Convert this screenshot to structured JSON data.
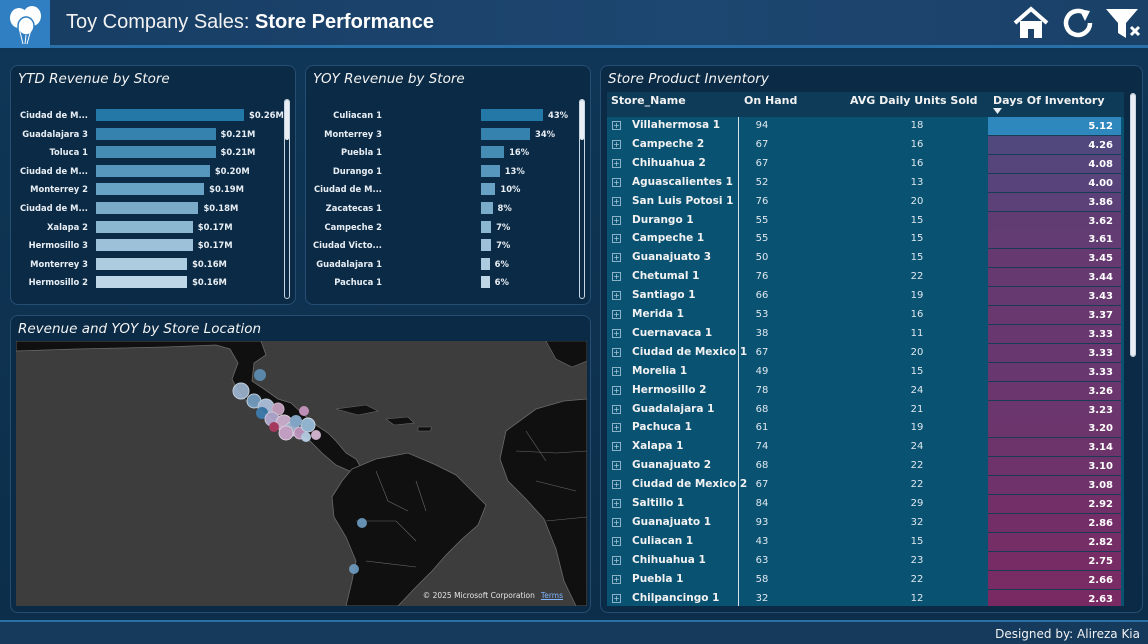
{
  "header": {
    "title_prefix": "Toy Company Sales:",
    "title_main": "Store Performance",
    "icons": [
      "balloon-logo-icon",
      "home-icon",
      "refresh-icon",
      "filter-icon"
    ]
  },
  "ytd_panel": {
    "title": "YTD Revenue by Store",
    "chart_data": {
      "type": "bar",
      "categories": [
        "Ciudad de M...",
        "Guadalajara 3",
        "Toluca 1",
        "Ciudad de M...",
        "Monterrey 2",
        "Ciudad de M...",
        "Xalapa 2",
        "Hermosillo 3",
        "Monterrey 3",
        "Hermosillo 2"
      ],
      "values": [
        0.26,
        0.21,
        0.21,
        0.2,
        0.19,
        0.18,
        0.17,
        0.17,
        0.16,
        0.16
      ],
      "labels": [
        "$0.26M",
        "$0.21M",
        "$0.21M",
        "$0.20M",
        "$0.19M",
        "$0.18M",
        "$0.17M",
        "$0.17M",
        "$0.16M",
        "$0.16M"
      ]
    }
  },
  "yoy_panel": {
    "title": "YOY Revenue by Store",
    "chart_data": {
      "type": "bar",
      "categories": [
        "Culiacan 1",
        "Monterrey 3",
        "Puebla 1",
        "Durango 1",
        "Ciudad de M...",
        "Zacatecas 1",
        "Campeche 2",
        "Ciudad Victo...",
        "Guadalajara 1",
        "Pachuca 1"
      ],
      "values": [
        43,
        34,
        16,
        13,
        10,
        8,
        7,
        7,
        6,
        6
      ],
      "labels": [
        "43%",
        "34%",
        "16%",
        "13%",
        "10%",
        "8%",
        "7%",
        "7%",
        "6%",
        "6%"
      ]
    }
  },
  "map_panel": {
    "title": "Revenue and YOY by Store Location",
    "credit": "© 2025 Microsoft Corporation",
    "terms": "Terms"
  },
  "inventory": {
    "title": "Store Product Inventory",
    "columns": [
      "Store_Name",
      "On Hand",
      "AVG Daily Units Sold",
      "Days Of Inventory"
    ],
    "sort_indicator": "sort-desc-icon",
    "rows": [
      {
        "name": "Villahermosa 1",
        "on_hand": "94",
        "avg": "18",
        "doi": "5.12"
      },
      {
        "name": "Campeche 2",
        "on_hand": "67",
        "avg": "16",
        "doi": "4.26"
      },
      {
        "name": "Chihuahua 2",
        "on_hand": "67",
        "avg": "16",
        "doi": "4.08"
      },
      {
        "name": "Aguascalientes 1",
        "on_hand": "52",
        "avg": "13",
        "doi": "4.00"
      },
      {
        "name": "San Luis Potosi 1",
        "on_hand": "76",
        "avg": "20",
        "doi": "3.86"
      },
      {
        "name": "Durango 1",
        "on_hand": "55",
        "avg": "15",
        "doi": "3.62"
      },
      {
        "name": "Campeche 1",
        "on_hand": "55",
        "avg": "15",
        "doi": "3.61"
      },
      {
        "name": "Guanajuato 3",
        "on_hand": "50",
        "avg": "15",
        "doi": "3.45"
      },
      {
        "name": "Chetumal 1",
        "on_hand": "76",
        "avg": "22",
        "doi": "3.44"
      },
      {
        "name": "Santiago 1",
        "on_hand": "66",
        "avg": "19",
        "doi": "3.43"
      },
      {
        "name": "Merida 1",
        "on_hand": "53",
        "avg": "16",
        "doi": "3.37"
      },
      {
        "name": "Cuernavaca 1",
        "on_hand": "38",
        "avg": "11",
        "doi": "3.33"
      },
      {
        "name": "Ciudad de Mexico 1",
        "on_hand": "67",
        "avg": "20",
        "doi": "3.33"
      },
      {
        "name": "Morelia 1",
        "on_hand": "49",
        "avg": "15",
        "doi": "3.33"
      },
      {
        "name": "Hermosillo 2",
        "on_hand": "78",
        "avg": "24",
        "doi": "3.26"
      },
      {
        "name": "Guadalajara 1",
        "on_hand": "68",
        "avg": "21",
        "doi": "3.23"
      },
      {
        "name": "Pachuca 1",
        "on_hand": "61",
        "avg": "19",
        "doi": "3.20"
      },
      {
        "name": "Xalapa 1",
        "on_hand": "74",
        "avg": "24",
        "doi": "3.14"
      },
      {
        "name": "Guanajuato 2",
        "on_hand": "68",
        "avg": "22",
        "doi": "3.10"
      },
      {
        "name": "Ciudad de Mexico 2",
        "on_hand": "67",
        "avg": "22",
        "doi": "3.08"
      },
      {
        "name": "Saltillo 1",
        "on_hand": "84",
        "avg": "29",
        "doi": "2.92"
      },
      {
        "name": "Guanajuato 1",
        "on_hand": "93",
        "avg": "32",
        "doi": "2.86"
      },
      {
        "name": "Culiacan 1",
        "on_hand": "43",
        "avg": "15",
        "doi": "2.82"
      },
      {
        "name": "Chihuahua 1",
        "on_hand": "63",
        "avg": "23",
        "doi": "2.75"
      },
      {
        "name": "Puebla 1",
        "on_hand": "58",
        "avg": "22",
        "doi": "2.66"
      },
      {
        "name": "Chilpancingo 1",
        "on_hand": "32",
        "avg": "12",
        "doi": "2.63"
      }
    ]
  },
  "footer": {
    "credit": "Designed by: Alireza Kia"
  },
  "colors": {
    "accent": "#2f7fc2",
    "doi_high": "#2e87bd",
    "doi_low": "#7a2a63"
  }
}
